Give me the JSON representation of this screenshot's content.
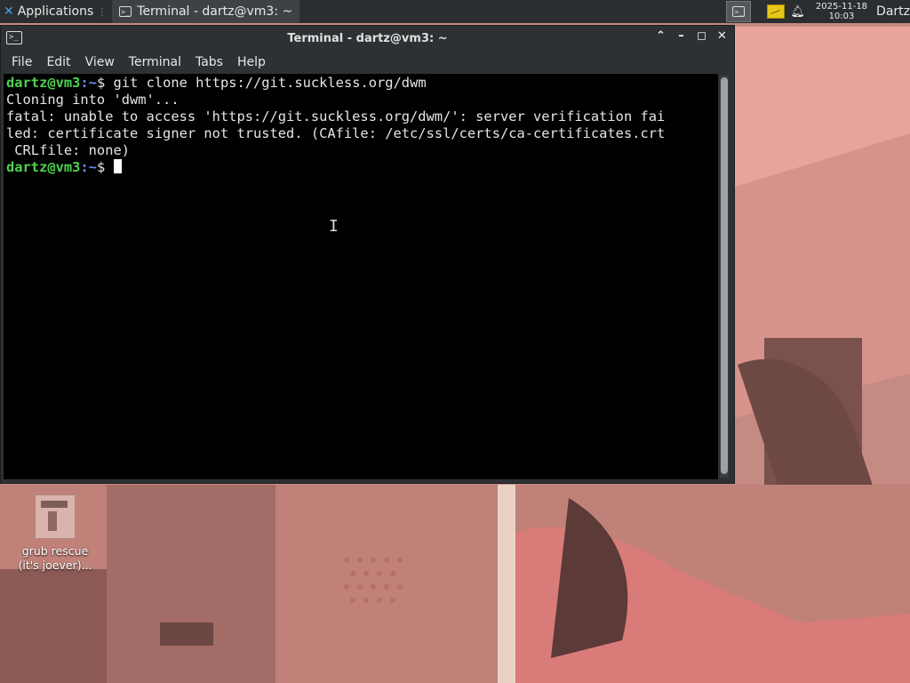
{
  "panel": {
    "apps_label": "Applications",
    "task_title": "Terminal - dartz@vm3: ~",
    "clock_date": "2025-11-18",
    "clock_time": "10:03",
    "user": "Dartz"
  },
  "window": {
    "title": "Terminal - dartz@vm3: ~",
    "menu": [
      "File",
      "Edit",
      "View",
      "Terminal",
      "Tabs",
      "Help"
    ]
  },
  "terminal": {
    "prompt_user": "dartz@vm3",
    "prompt_dir": ":~",
    "prompt_symbol": "$ ",
    "command": "git clone https://git.suckless.org/dwm",
    "output": [
      "Cloning into 'dwm'...",
      "fatal: unable to access 'https://git.suckless.org/dwm/': server verification fai",
      "led: certificate signer not trusted. (CAfile: /etc/ssl/certs/ca-certificates.crt",
      " CRLfile: none)"
    ]
  },
  "desktop": {
    "icon_label_1": "grub rescue",
    "icon_label_2": "(it's joever)..."
  },
  "colors": {
    "panel_bg": "#2b2e30",
    "window_bg": "#2e3133",
    "prompt_user": "#4fd34f",
    "prompt_dir": "#6a8cff",
    "terminal_bg": "#000000"
  }
}
